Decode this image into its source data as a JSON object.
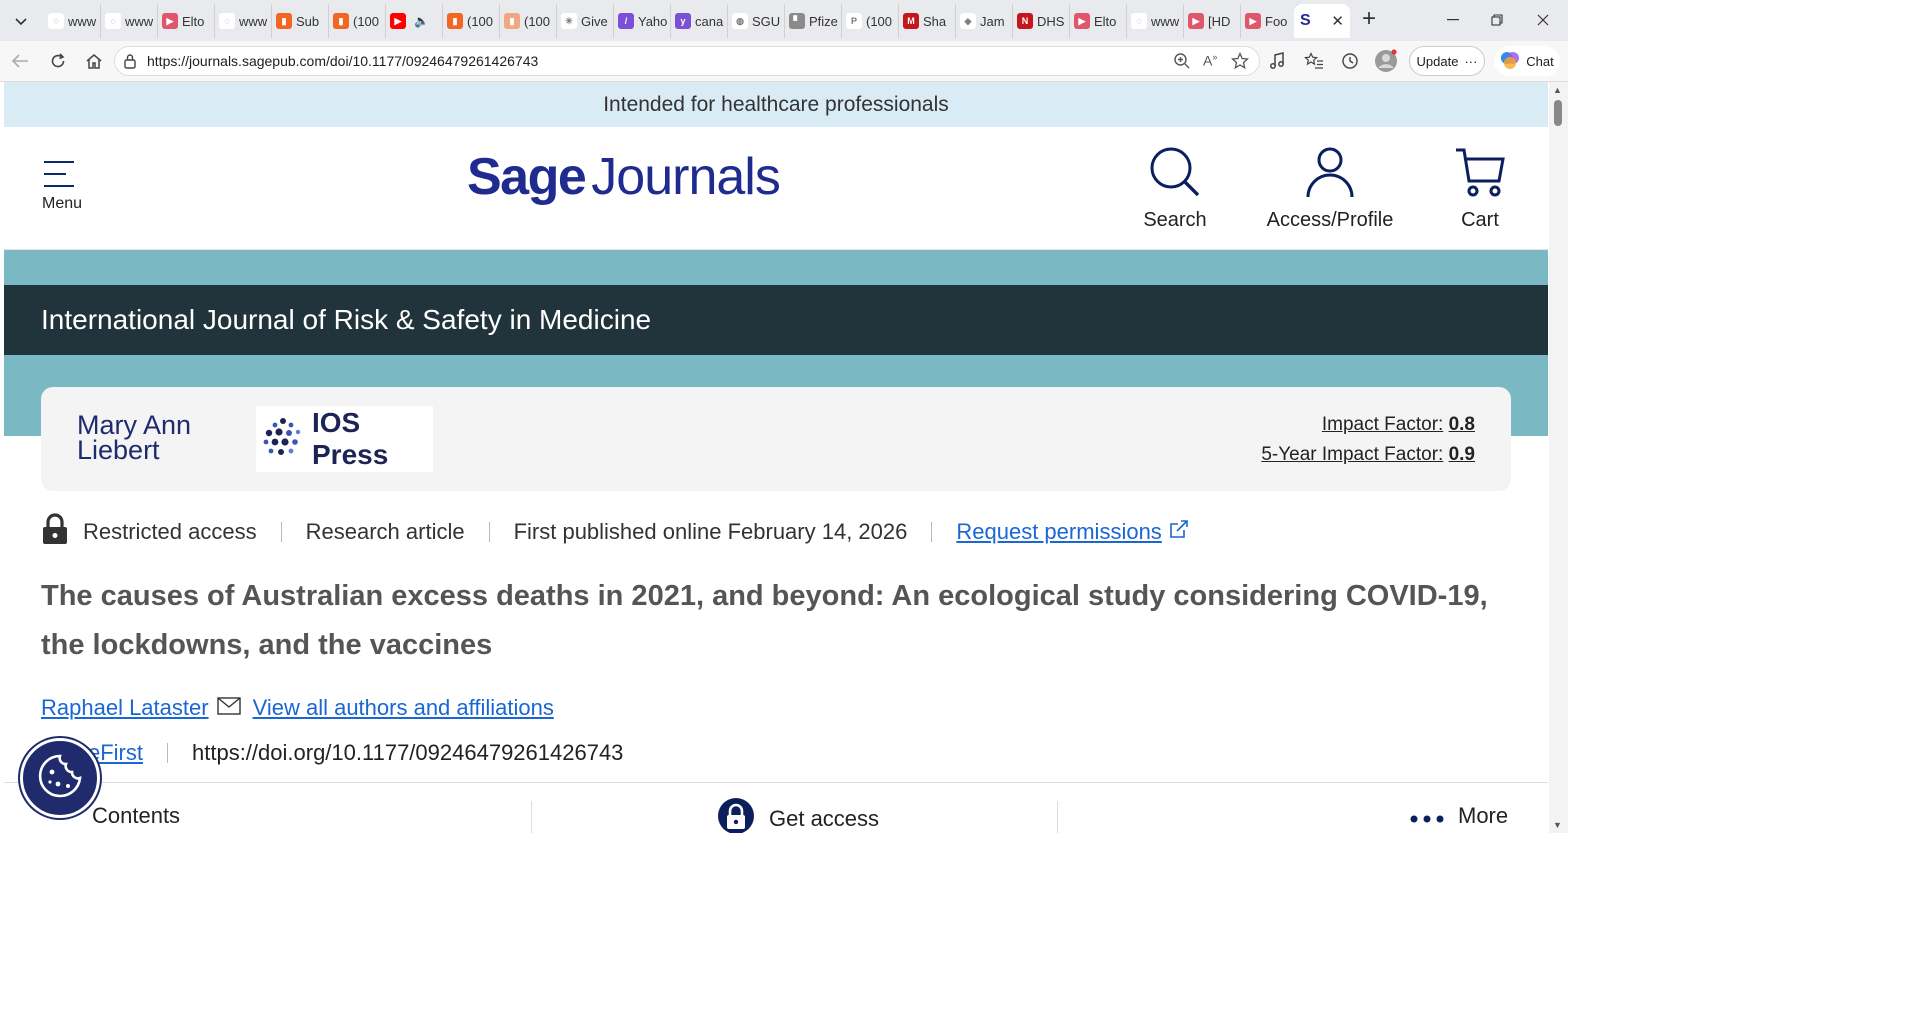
{
  "browser": {
    "tabs": [
      {
        "label": "www",
        "color": "#ffffff",
        "glyph": "◌"
      },
      {
        "label": "www",
        "color": "#ffffff",
        "glyph": "◌"
      },
      {
        "label": "Elto",
        "color": "#e0566b",
        "glyph": "▶"
      },
      {
        "label": "www",
        "color": "#ffffff",
        "glyph": "◌"
      },
      {
        "label": "Sub",
        "color": "#f26522",
        "glyph": "▮"
      },
      {
        "label": "(100",
        "color": "#f26522",
        "glyph": "▮"
      },
      {
        "label": "",
        "color": "#ff0000",
        "glyph": "▶"
      },
      {
        "label": "(100",
        "color": "#f26522",
        "glyph": "▮"
      },
      {
        "label": "(100",
        "color": "#f0a884",
        "glyph": "▮"
      },
      {
        "label": "Give",
        "color": "#ffffff",
        "glyph": "✳"
      },
      {
        "label": "Yaho",
        "color": "#7b4fd6",
        "glyph": "/"
      },
      {
        "label": "cana",
        "color": "#7b4fd6",
        "glyph": "y"
      },
      {
        "label": "SGU",
        "color": "#ffffff",
        "glyph": "◍"
      },
      {
        "label": "Pfize",
        "color": "#8a8a8a",
        "glyph": "▘"
      },
      {
        "label": "(100",
        "color": "#ffffff",
        "glyph": "P"
      },
      {
        "label": "Sha",
        "color": "#c4161c",
        "glyph": "M"
      },
      {
        "label": "Jam",
        "color": "#ffffff",
        "glyph": "◈"
      },
      {
        "label": "DHS",
        "color": "#c4161c",
        "glyph": "N"
      },
      {
        "label": "Elto",
        "color": "#e0566b",
        "glyph": "▶"
      },
      {
        "label": "www",
        "color": "#ffffff",
        "glyph": "◌"
      },
      {
        "label": "[HD",
        "color": "#e0566b",
        "glyph": "▶"
      },
      {
        "label": "Foo",
        "color": "#e0566b",
        "glyph": "▶"
      }
    ],
    "active_tab_glyph": "S",
    "url": "https://journals.sagepub.com/doi/10.1177/09246479261426743",
    "update_label": "Update",
    "chat_label": "Chat"
  },
  "page": {
    "banner": "Intended for healthcare professionals",
    "header": {
      "menu_label": "Menu",
      "logo_sage": "Sage",
      "logo_journals": "Journals",
      "search_label": "Search",
      "access_label": "Access/Profile",
      "cart_label": "Cart"
    },
    "journal_title": "International Journal of Risk & Safety in Medicine",
    "publishers": {
      "mal_line1": "Mary Ann",
      "mal_line2": "Liebert",
      "ios": "IOS Press"
    },
    "metrics": {
      "impact_label": "Impact Factor:",
      "impact_value": "0.8",
      "five_year_label": "5-Year Impact Factor:",
      "five_year_value": "0.9"
    },
    "meta": {
      "access": "Restricted access",
      "type": "Research article",
      "published": "First published online February 14, 2026",
      "permissions": "Request permissions"
    },
    "title": "The causes of Australian excess deaths in 2021, and beyond: An ecological study considering COVID-19, the lockdowns, and the vaccines",
    "author": "Raphael Lataster",
    "view_authors": "View all authors and affiliations",
    "online_first": "eFirst",
    "doi": "https://doi.org/10.1177/09246479261426743",
    "bottom": {
      "contents": "Contents",
      "get_access": "Get access",
      "more": "More"
    }
  },
  "colors": {
    "brand_navy": "#1f2b8f",
    "journal_bar": "#21333b",
    "teal": "#7ab8c4",
    "link": "#1a66d4",
    "banner_bg": "#d9ecf5"
  }
}
